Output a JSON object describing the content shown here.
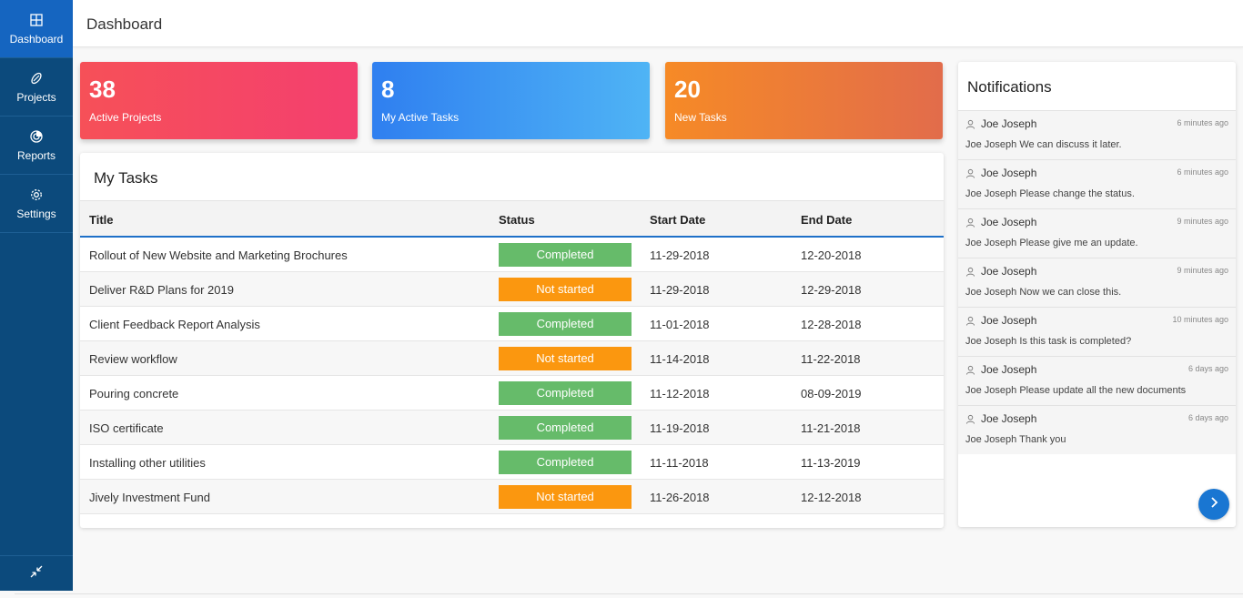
{
  "sidebar": {
    "items": [
      {
        "label": "Dashboard",
        "icon": "dashboard-icon",
        "active": true
      },
      {
        "label": "Projects",
        "icon": "projects-icon",
        "active": false
      },
      {
        "label": "Reports",
        "icon": "reports-icon",
        "active": false
      },
      {
        "label": "Settings",
        "icon": "gear-icon",
        "active": false
      }
    ],
    "collapse_icon": "collapse-icon"
  },
  "header": {
    "title": "Dashboard"
  },
  "stats": [
    {
      "value": "38",
      "label": "Active Projects"
    },
    {
      "value": "8",
      "label": "My Active Tasks"
    },
    {
      "value": "20",
      "label": "New Tasks"
    }
  ],
  "tasks": {
    "title": "My Tasks",
    "columns": [
      "Title",
      "Status",
      "Start Date",
      "End Date"
    ],
    "rows": [
      {
        "title": "Rollout of New Website and Marketing Brochures",
        "status": "Completed",
        "start": "11-29-2018",
        "end": "12-20-2018"
      },
      {
        "title": "Deliver R&D Plans for 2019",
        "status": "Not started",
        "start": "11-29-2018",
        "end": "12-29-2018"
      },
      {
        "title": "Client Feedback Report Analysis",
        "status": "Completed",
        "start": "11-01-2018",
        "end": "12-28-2018"
      },
      {
        "title": "Review workflow",
        "status": "Not started",
        "start": "11-14-2018",
        "end": "11-22-2018"
      },
      {
        "title": "Pouring concrete",
        "status": "Completed",
        "start": "11-12-2018",
        "end": "08-09-2019"
      },
      {
        "title": "ISO certificate",
        "status": "Completed",
        "start": "11-19-2018",
        "end": "11-21-2018"
      },
      {
        "title": "Installing other utilities",
        "status": "Completed",
        "start": "11-11-2018",
        "end": "11-13-2019"
      },
      {
        "title": "Jively Investment Fund",
        "status": "Not started",
        "start": "11-26-2018",
        "end": "12-12-2018"
      }
    ]
  },
  "notifications": {
    "title": "Notifications",
    "items": [
      {
        "user": "Joe Joseph",
        "time": "6 minutes ago",
        "message": "Joe Joseph We can discuss it later."
      },
      {
        "user": "Joe Joseph",
        "time": "6 minutes ago",
        "message": "Joe Joseph Please change the status."
      },
      {
        "user": "Joe Joseph",
        "time": "9 minutes ago",
        "message": "Joe Joseph Please give me an update."
      },
      {
        "user": "Joe Joseph",
        "time": "9 minutes ago",
        "message": "Joe Joseph Now we can close this."
      },
      {
        "user": "Joe Joseph",
        "time": "10 minutes ago",
        "message": "Joe Joseph Is this task is completed?"
      },
      {
        "user": "Joe Joseph",
        "time": "6 days ago",
        "message": "Joe Joseph Please update all the new documents"
      },
      {
        "user": "Joe Joseph",
        "time": "6 days ago",
        "message": "Joe Joseph Thank you"
      }
    ],
    "next_icon": "chevron-right-icon"
  },
  "colors": {
    "sidebar": "#0c4a7c",
    "sidebar_active": "#1565c0",
    "completed": "#66bb6a",
    "not_started": "#fb970f",
    "accent": "#1976d2"
  }
}
